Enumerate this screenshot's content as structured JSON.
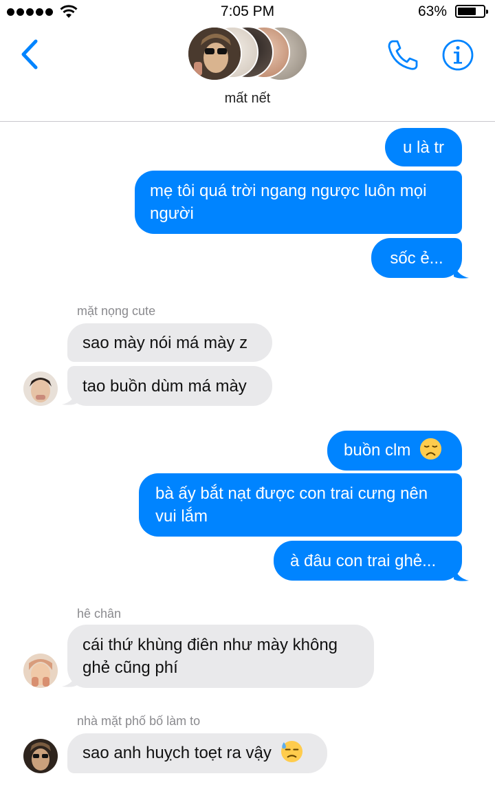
{
  "status_bar": {
    "time": "7:05 PM",
    "battery_percent": "63%",
    "battery_level": 0.63,
    "signal_bars": 5
  },
  "header": {
    "group_name": "mất nết",
    "accent_color": "#0084ff"
  },
  "messages": [
    {
      "direction": "out",
      "text": "u là tr"
    },
    {
      "direction": "out",
      "text": "mẹ tôi quá trời ngang ngược luôn mọi người"
    },
    {
      "direction": "out",
      "text": "sốc ẻ..."
    },
    {
      "direction": "in",
      "sender": "mặt nọng cute",
      "text": "sao mày nói má mày z"
    },
    {
      "direction": "in",
      "text": "tao buồn dùm má mày"
    },
    {
      "direction": "out",
      "text": "buồn clm",
      "emoji": "disappointed-face"
    },
    {
      "direction": "out",
      "text": "bà ấy bắt nạt được con trai cưng nên vui lắm"
    },
    {
      "direction": "out",
      "text": "à đâu con trai ghẻ..."
    },
    {
      "direction": "in",
      "sender": "hê chân",
      "text": "cái thứ khùng điên như mày không ghẻ cũng phí"
    },
    {
      "direction": "in",
      "sender": "nhà mặt phố bố làm to",
      "text": "sao anh huỵch toẹt ra vậy",
      "emoji": "downcast-sweat-face"
    }
  ]
}
